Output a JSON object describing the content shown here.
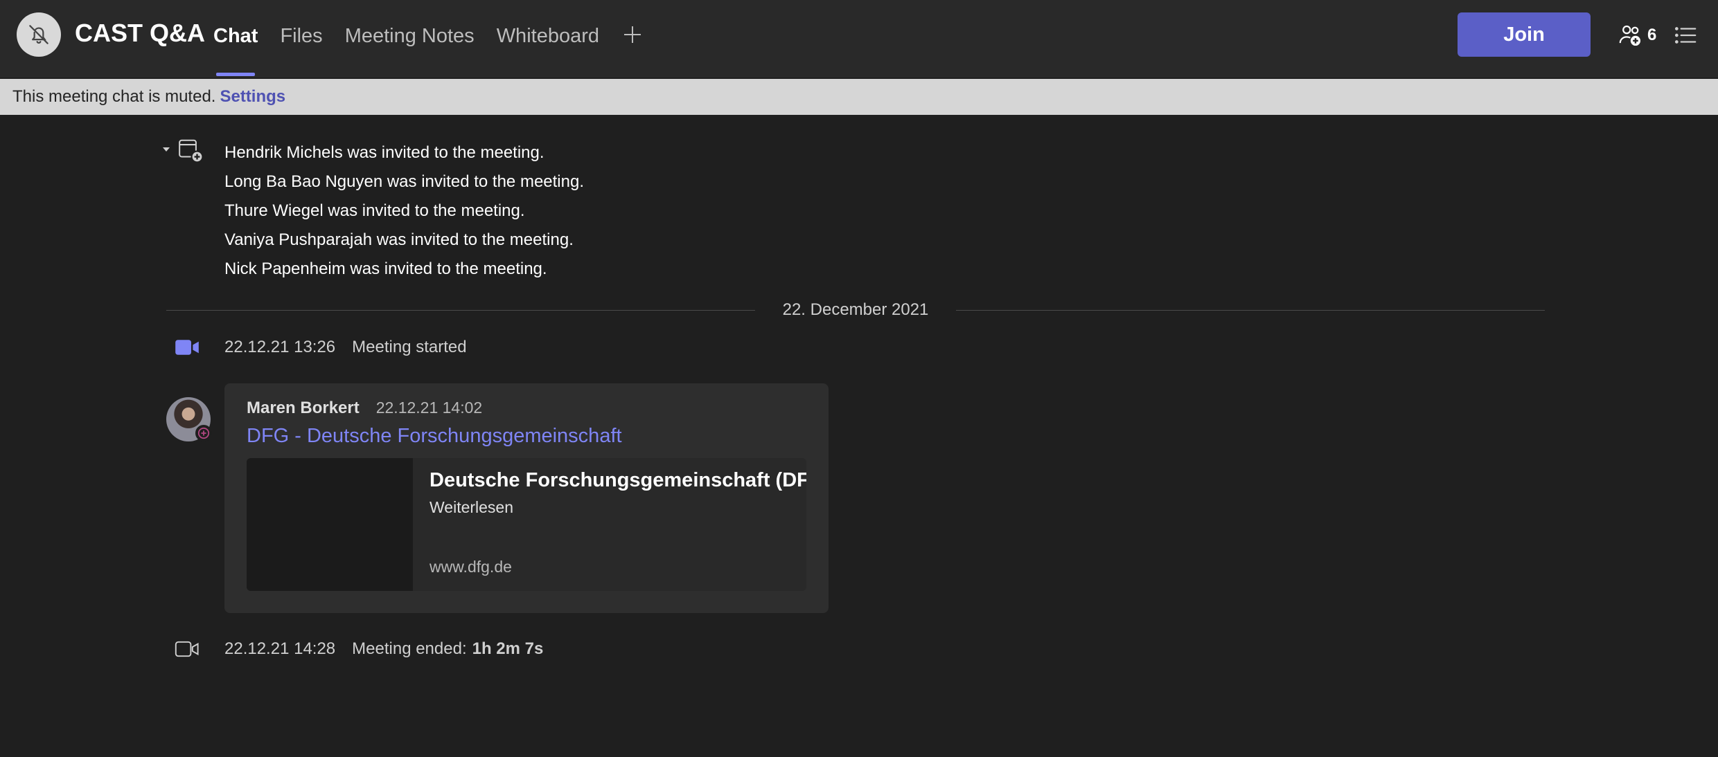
{
  "header": {
    "title": "CAST Q&A",
    "tabs": [
      "Chat",
      "Files",
      "Meeting Notes",
      "Whiteboard"
    ],
    "active_tab": "Chat",
    "join_label": "Join",
    "participants_count": "6"
  },
  "banner": {
    "text": "This meeting chat is muted.",
    "link": "Settings"
  },
  "invites": [
    "Hendrik Michels was invited to the meeting.",
    "Long Ba Bao Nguyen was invited to the meeting.",
    "Thure Wiegel was invited to the meeting.",
    "Vaniya Pushparajah was invited to the meeting.",
    "Nick Papenheim was invited to the meeting."
  ],
  "date_divider": "22. December 2021",
  "meeting_started": {
    "time": "22.12.21 13:26",
    "text": "Meeting started"
  },
  "message": {
    "author": "Maren Borkert",
    "time": "22.12.21 14:02",
    "link_text": "DFG - Deutsche Forschungsgemeinschaft",
    "preview": {
      "title": "Deutsche Forschungsgemeinschaft (DFG)",
      "subtitle": "Weiterlesen",
      "url": "www.dfg.de"
    }
  },
  "meeting_ended": {
    "time": "22.12.21 14:28",
    "text": "Meeting ended:",
    "duration": "1h 2m 7s"
  },
  "colors": {
    "accent": "#5b5fc7",
    "link": "#7f85f5",
    "background": "#1f1f1f",
    "header": "#292929",
    "banner": "#d6d6d6"
  },
  "icons": [
    "bell-off-icon",
    "plus-icon",
    "people-add-icon",
    "list-icon",
    "chevron-down-icon",
    "invite-icon",
    "video-camera-icon",
    "presence-icon"
  ]
}
